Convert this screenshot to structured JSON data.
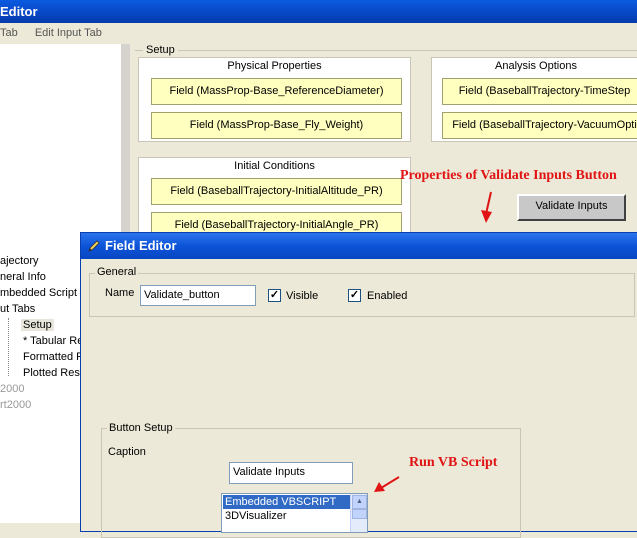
{
  "app": {
    "title": "Editor",
    "menu": [
      "Tab",
      "Edit Input Tab"
    ]
  },
  "tree": {
    "items": [
      {
        "label": "ajectory"
      },
      {
        "label": "neral Info"
      },
      {
        "label": "mbedded Script"
      },
      {
        "label": "ut Tabs"
      },
      {
        "label": "Setup"
      },
      {
        "label": "* Tabular Re"
      },
      {
        "label": "Formatted R"
      },
      {
        "label": "Plotted Resu"
      },
      {
        "label": "2000"
      },
      {
        "label": "rt2000"
      }
    ]
  },
  "setup": {
    "label": "Setup",
    "physical": {
      "title": "Physical Properties",
      "fields": [
        "Field (MassProp-Base_ReferenceDiameter)",
        "Field (MassProp-Base_Fly_Weight)"
      ]
    },
    "analysis": {
      "title": "Analysis Options",
      "fields": [
        "Field (BaseballTrajectory-TimeStep",
        "Field (BaseballTrajectory-VacuumOpti"
      ]
    },
    "initial": {
      "title": "Initial Conditions",
      "fields": [
        "Field (BaseballTrajectory-InitialAltitude_PR)",
        "Field (BaseballTrajectory-InitialAngle_PR)"
      ]
    },
    "validate_button": "Validate Inputs"
  },
  "annotations": {
    "properties_label": "Properties of Validate Inputs Button",
    "run_vb_label": "Run VB Script",
    "color": "#e01414"
  },
  "field_editor": {
    "title": "Field Editor",
    "general_label": "General",
    "name_label": "Name",
    "name_value": "Validate_button",
    "visible_label": "Visible",
    "visible_checked": true,
    "enabled_label": "Enabled",
    "enabled_checked": true,
    "button_setup_label": "Button Setup",
    "caption_label": "Caption",
    "caption_value": "Validate Inputs",
    "action_options": [
      "Embedded VBSCRIPT",
      "3DVisualizer"
    ],
    "selected_action": "Embedded VBSCRIPT"
  },
  "icons": {
    "field_editor_icon": "pencil-icon",
    "scroll_up": "scroll-up-arrow-icon",
    "scroll_down": "scroll-down-arrow-icon"
  },
  "colors": {
    "titlebar": "#0746c4",
    "field_fill": "#ffffc0",
    "selection": "#316ac5"
  }
}
